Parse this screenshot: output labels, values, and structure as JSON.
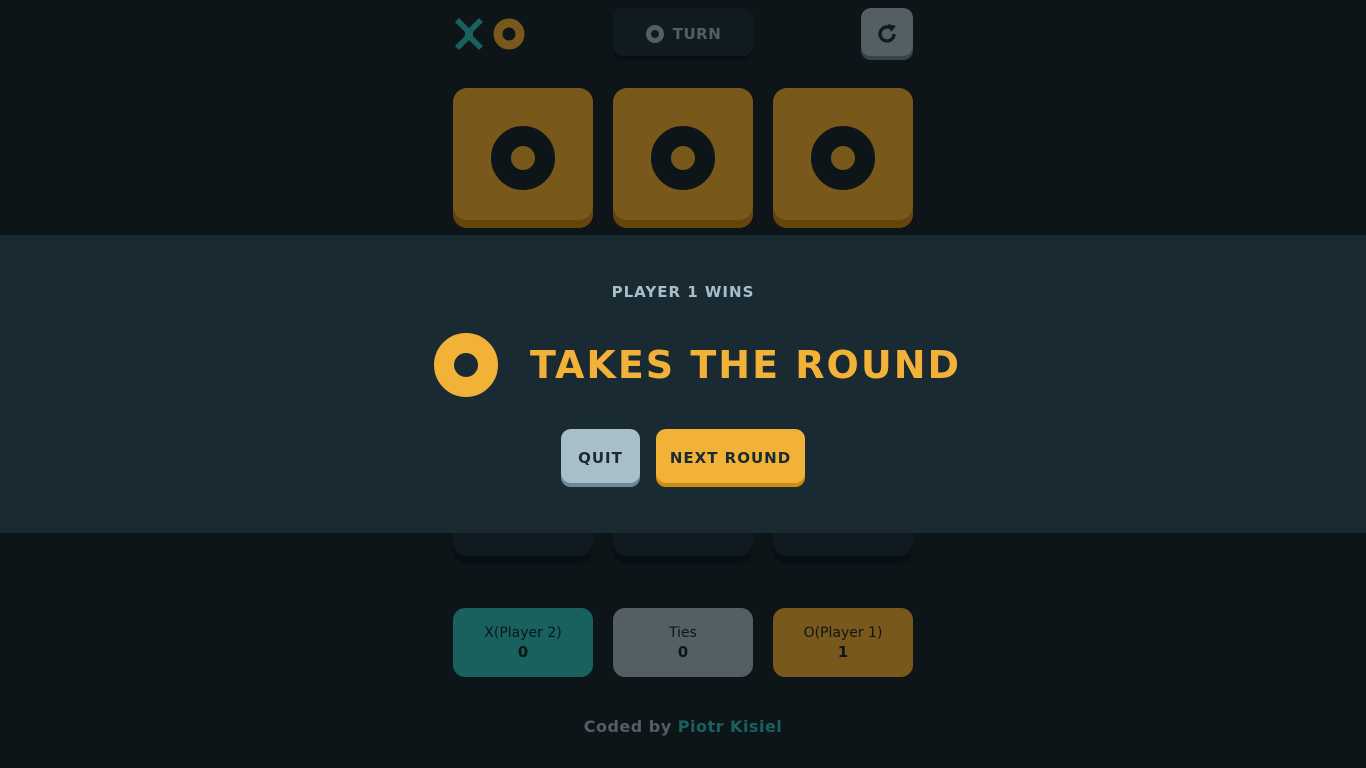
{
  "header": {
    "logo_icons": [
      "x-mark-icon",
      "o-mark-icon"
    ],
    "turn_label": "TURN",
    "turn_mark": "o-mark-icon",
    "restart_icon": "restart-icon"
  },
  "board": {
    "cells": [
      "O",
      "O",
      "O",
      "",
      "",
      "",
      "",
      "",
      ""
    ],
    "winning_cells": [
      0,
      1,
      2
    ]
  },
  "scores": {
    "x": {
      "label": "X(Player 2)",
      "value": "0"
    },
    "ties": {
      "label": "Ties",
      "value": "0"
    },
    "o": {
      "label": "O(Player 1)",
      "value": "1"
    }
  },
  "modal": {
    "result": "PLAYER 1 WINS",
    "headline": "TAKES THE ROUND",
    "winner_mark": "o-mark-icon",
    "quit_label": "QUIT",
    "next_label": "NEXT ROUND"
  },
  "footer": {
    "prefix": "Coded by",
    "author": "Piotr Kisiel"
  },
  "colors": {
    "x_teal": "#31c3bd",
    "o_yellow": "#f2b137",
    "silver": "#a8bfc9",
    "background": "#1a2a33",
    "cell": "#1f3641"
  }
}
